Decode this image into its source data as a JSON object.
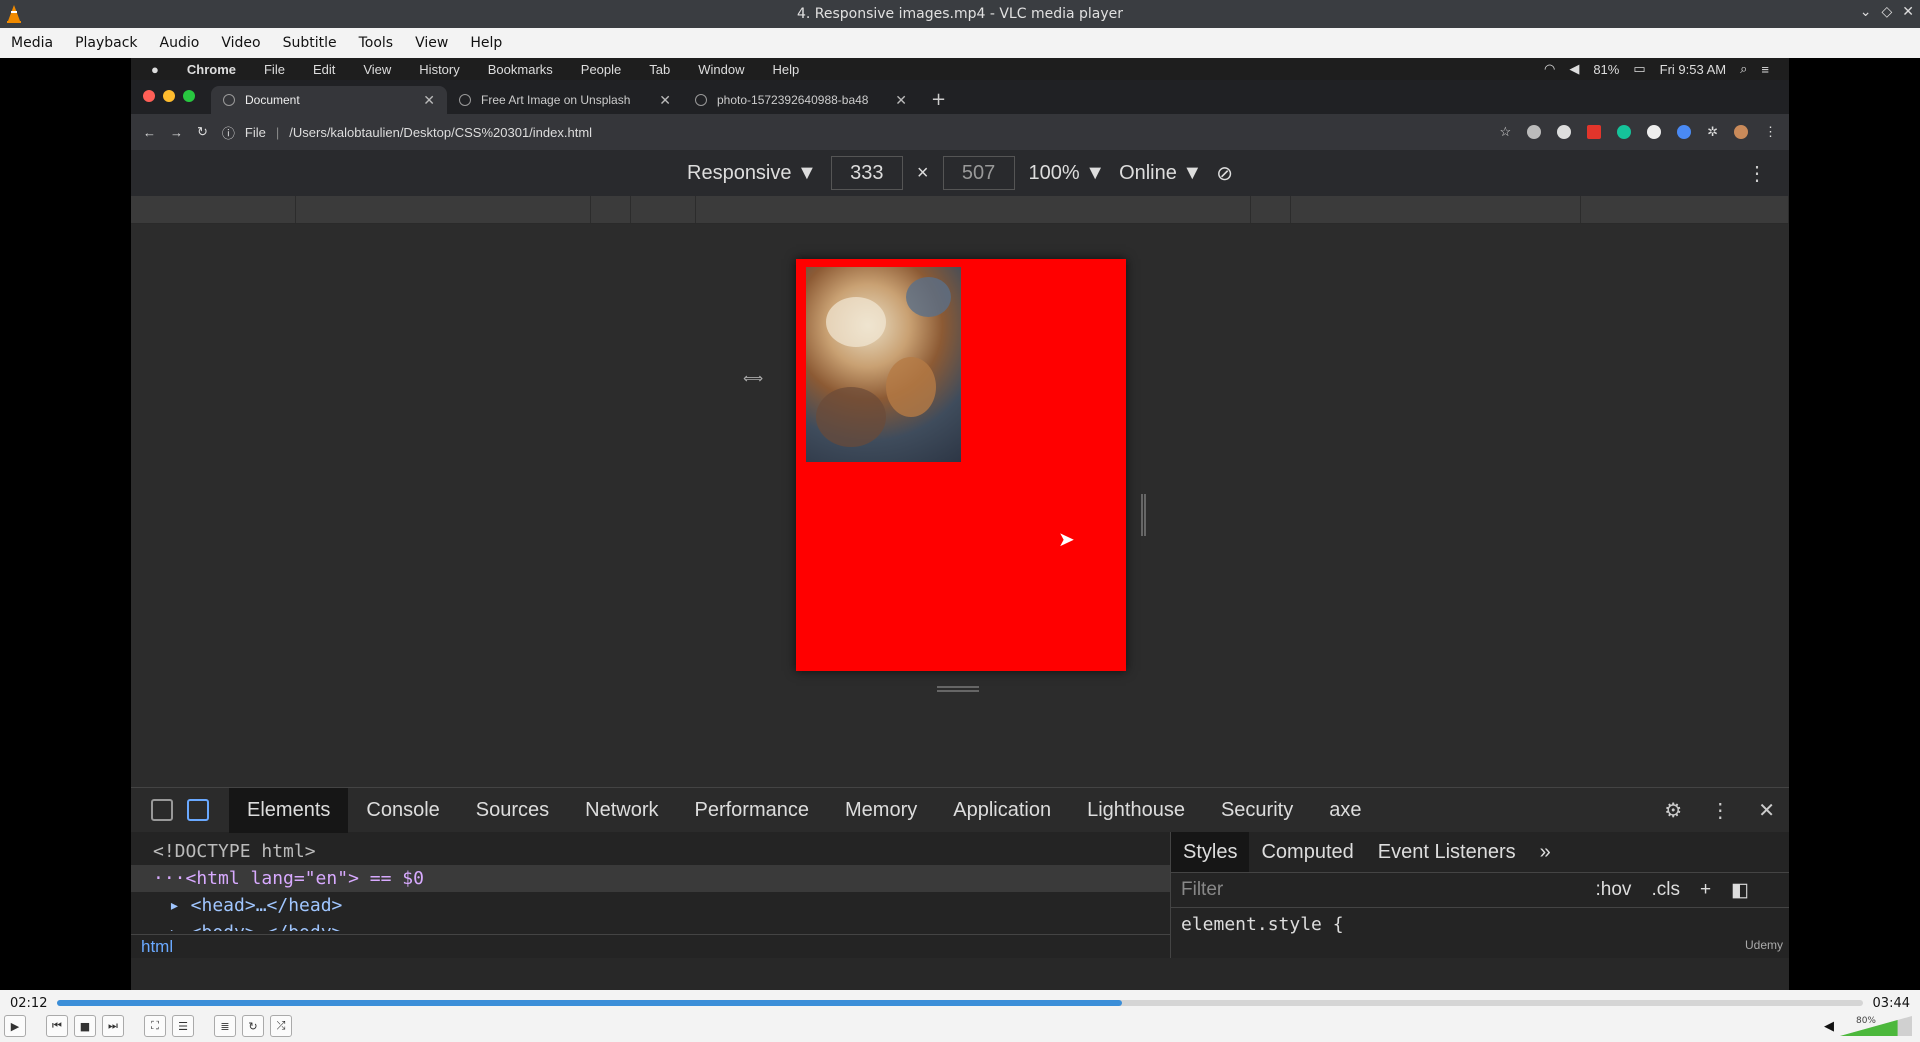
{
  "vlc": {
    "title": "4. Responsive images.mp4 - VLC media player",
    "menu": [
      "Media",
      "Playback",
      "Audio",
      "Video",
      "Subtitle",
      "Tools",
      "View",
      "Help"
    ],
    "window_controls": [
      "⌄",
      "◇",
      "✕"
    ],
    "time_elapsed": "02:12",
    "time_total": "03:44",
    "progress_fraction": 0.59,
    "volume_label": "80%",
    "volume_fraction": 0.8
  },
  "mac": {
    "apple": "",
    "app": "Chrome",
    "menu": [
      "File",
      "Edit",
      "View",
      "History",
      "Bookmarks",
      "People",
      "Tab",
      "Window",
      "Help"
    ],
    "battery": "81%",
    "clock": "Fri 9:53 AM"
  },
  "chrome": {
    "tabs": [
      {
        "title": "Document"
      },
      {
        "title": "Free Art Image on Unsplash"
      },
      {
        "title": "photo-1572392640988-ba48"
      }
    ],
    "new_tab": "+",
    "url_scheme": "File",
    "url": "/Users/kalobtaulien/Desktop/CSS%20301/index.html"
  },
  "device_toolbar": {
    "mode": "Responsive ▼",
    "width": "333",
    "times": "×",
    "height": "507",
    "zoom": "100% ▼",
    "network": "Online ▼"
  },
  "devtools": {
    "tabs": [
      "Elements",
      "Console",
      "Sources",
      "Network",
      "Performance",
      "Memory",
      "Application",
      "Lighthouse",
      "Security",
      "axe"
    ],
    "dom": {
      "line1": "<!DOCTYPE html>",
      "line2": "···<html lang=\"en\"> == $0",
      "line3": "▸ <head>…</head>",
      "line4": "▸ <body>…</body>",
      "breadcrumb": "html"
    },
    "styles_tabs": [
      "Styles",
      "Computed",
      "Event Listeners",
      "»"
    ],
    "filter_placeholder": "Filter",
    "hov": ":hov",
    "cls": ".cls",
    "rule": "element.style {",
    "watermark": "Udemy"
  }
}
